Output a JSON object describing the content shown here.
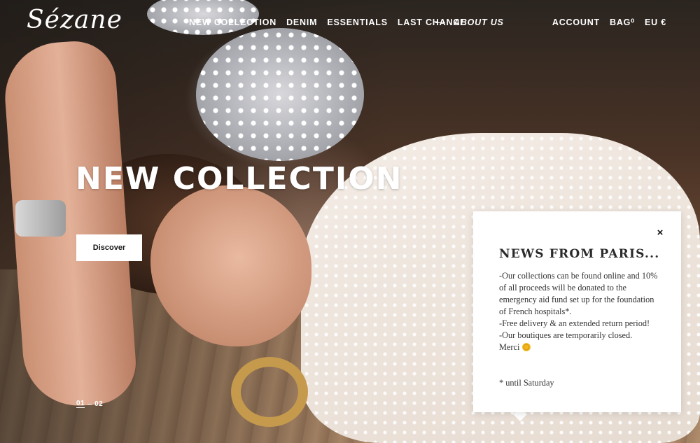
{
  "header": {
    "logo_text": "Sézane",
    "nav_left": [
      "NEW COLLECTION",
      "DENIM",
      "ESSENTIALS",
      "LAST CHANCE"
    ],
    "about": "ABOUT US",
    "nav_right": {
      "account": "ACCOUNT",
      "bag": "BAG⁰",
      "region": "EU €"
    }
  },
  "hero": {
    "title": "NEW COLLECTION",
    "cta": "Discover",
    "pager": {
      "current": "01",
      "total": "02"
    }
  },
  "popup": {
    "title": "NEWS FROM PARIS...",
    "close_label": "×",
    "lines": [
      "-Our collections can be found online and 10% of all proceeds will be donated to the emergency aid fund set up for the foundation of French hospitals*.",
      "-Free delivery & an extended return period!",
      "-Our boutiques are temporarily closed.",
      "Merci"
    ],
    "footnote": "* until Saturday"
  }
}
